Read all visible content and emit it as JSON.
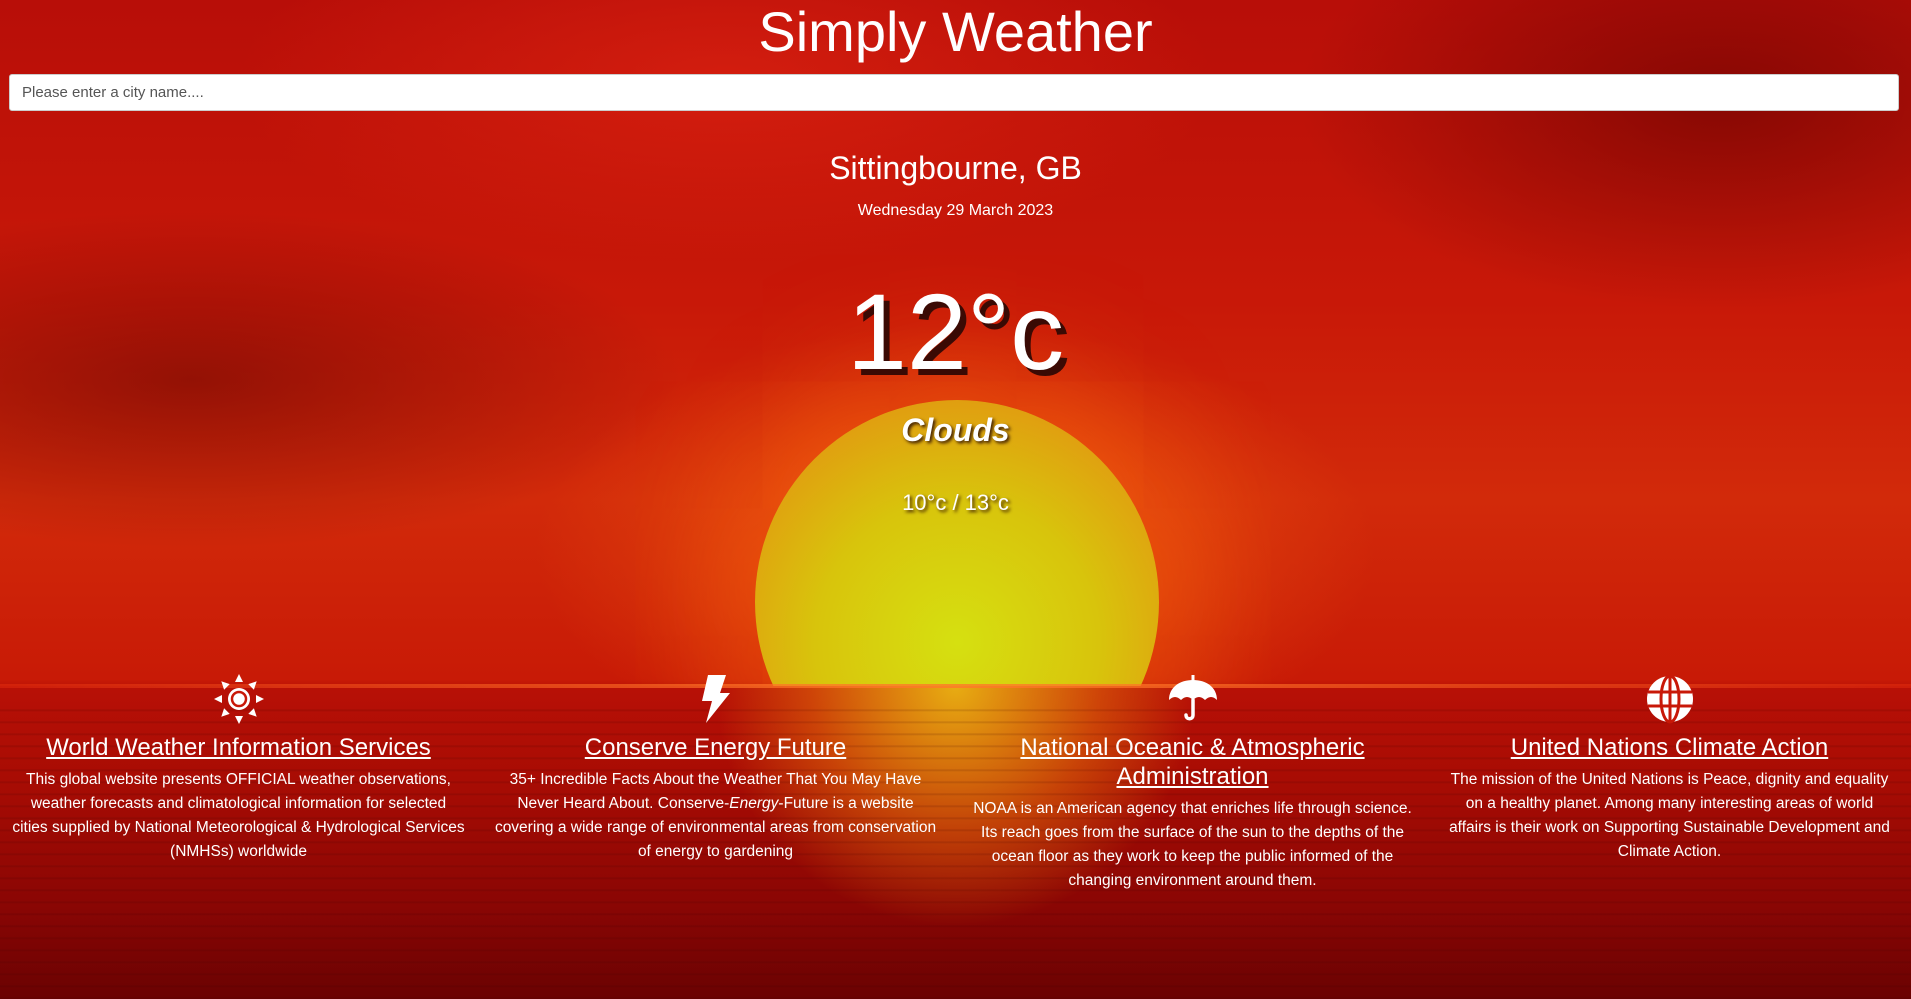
{
  "header": {
    "title": "Simply Weather"
  },
  "search": {
    "placeholder": "Please enter a city name...."
  },
  "weather": {
    "location": "Sittingbourne, GB",
    "date": "Wednesday 29 March 2023",
    "temperature": "12°c",
    "condition": "Clouds",
    "range": "10°c / 13°c"
  },
  "resources": [
    {
      "icon": "sun-icon",
      "title": "World Weather Information Services",
      "description": "This global website presents OFFICIAL weather observations, weather forecasts and climatological information for selected cities supplied by National Meteorological & Hydrological Services (NMHSs) worldwide"
    },
    {
      "icon": "bolt-icon",
      "title": "Conserve Energy Future",
      "description_before": "35+ Incredible Facts About the Weather That You May Have Never Heard About. Conserve-",
      "description_em": "Energy",
      "description_after": "-Future is a website covering a wide range of environmental areas from conservation of energy to gardening"
    },
    {
      "icon": "umbrella-icon",
      "title": "National Oceanic & Atmospheric Administration",
      "description": "NOAA is an American agency that enriches life through science. Its reach goes from the surface of the sun to the depths of the ocean floor as they work to keep the public informed of the changing environment around them."
    },
    {
      "icon": "globe-icon",
      "title": "United Nations Climate Action",
      "description": "The mission of the United Nations is Peace, dignity and equality on a healthy planet. Among many interesting areas of world affairs is their work on Supporting Sustainable Development and Climate Action."
    }
  ],
  "colors": {
    "sky": "#c81808",
    "sun": "#d6e010",
    "text": "#ffffff"
  }
}
